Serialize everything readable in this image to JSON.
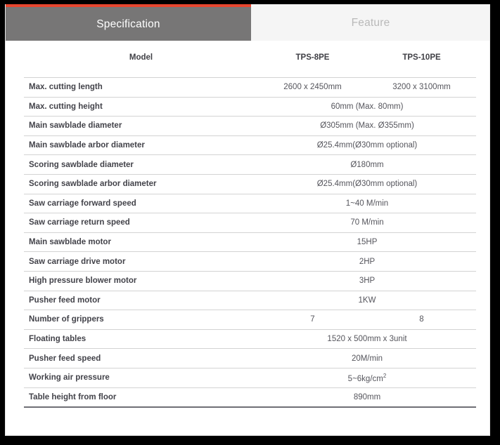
{
  "tabs": [
    {
      "id": "specification",
      "label": "Specification",
      "active": true
    },
    {
      "id": "feature",
      "label": "Feature",
      "active": false
    }
  ],
  "accent_color": "#e8462f",
  "active_tab_bg": "#777676",
  "inactive_tab_bg": "#f5f5f5",
  "table": {
    "headers": {
      "label": "Model",
      "col1": "TPS-8PE",
      "col2": "TPS-10PE"
    },
    "rows": [
      {
        "label": "Max. cutting length",
        "merged": false,
        "col1": "2600 x 2450mm",
        "col2": "3200 x 3100mm"
      },
      {
        "label": "Max. cutting height",
        "merged": true,
        "value": "60mm (Max. 80mm)"
      },
      {
        "label": "Main sawblade diameter",
        "merged": true,
        "value": "Ø305mm (Max. Ø355mm)"
      },
      {
        "label": "Main sawblade arbor diameter",
        "merged": true,
        "value": "Ø25.4mm(Ø30mm optional)"
      },
      {
        "label": "Scoring sawblade diameter",
        "merged": true,
        "value": "Ø180mm"
      },
      {
        "label": "Scoring sawblade arbor diameter",
        "merged": true,
        "value": "Ø25.4mm(Ø30mm optional)"
      },
      {
        "label": "Saw carriage forward speed",
        "merged": true,
        "value": "1~40 M/min"
      },
      {
        "label": "Saw carriage return speed",
        "merged": true,
        "value": "70 M/min"
      },
      {
        "label": "Main sawblade motor",
        "merged": true,
        "value": "15HP"
      },
      {
        "label": "Saw carriage drive motor",
        "merged": true,
        "value": "2HP"
      },
      {
        "label": "High pressure blower motor",
        "merged": true,
        "value": "3HP"
      },
      {
        "label": "Pusher feed motor",
        "merged": true,
        "value": "1KW"
      },
      {
        "label": "Number of grippers",
        "merged": false,
        "col1": "7",
        "col2": "8"
      },
      {
        "label": "Floating tables",
        "merged": true,
        "value": "1520 x 500mm x 3unit"
      },
      {
        "label": "Pusher feed speed",
        "merged": true,
        "value": "20M/min"
      },
      {
        "label": "Working air pressure",
        "merged": true,
        "value": "5~6kg/cm",
        "sup": "2"
      },
      {
        "label": "Table height from floor",
        "merged": true,
        "value": "890mm"
      }
    ]
  }
}
